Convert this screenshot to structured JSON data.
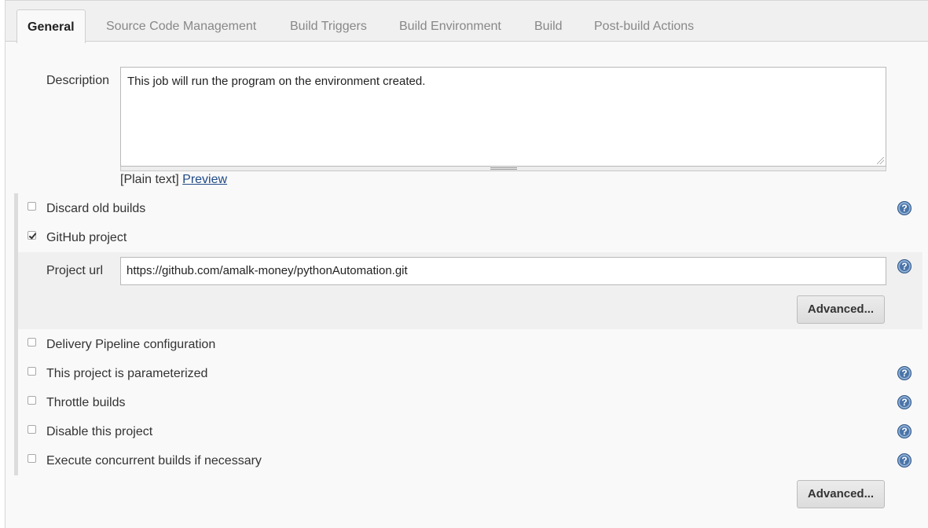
{
  "tabs": [
    {
      "label": "General",
      "active": true
    },
    {
      "label": "Source Code Management"
    },
    {
      "label": "Build Triggers"
    },
    {
      "label": "Build Environment"
    },
    {
      "label": "Build"
    },
    {
      "label": "Post-build Actions"
    }
  ],
  "description": {
    "label": "Description",
    "value": "This job will run the program on the environment created.",
    "format_text": "[Plain text]",
    "preview_link": "Preview"
  },
  "options": [
    {
      "label": "Discard old builds",
      "checked": false,
      "help": true
    },
    {
      "label": "GitHub project",
      "checked": true,
      "help": false
    },
    {
      "label": "Delivery Pipeline configuration",
      "checked": false,
      "help": false
    },
    {
      "label": "This project is parameterized",
      "checked": false,
      "help": true
    },
    {
      "label": "Throttle builds",
      "checked": false,
      "help": true
    },
    {
      "label": "Disable this project",
      "checked": false,
      "help": true
    },
    {
      "label": "Execute concurrent builds if necessary",
      "checked": false,
      "help": true
    }
  ],
  "github": {
    "url_label": "Project url",
    "url_value": "https://github.com/amalk-money/pythonAutomation.git",
    "advanced_label": "Advanced..."
  },
  "footer": {
    "advanced_label": "Advanced..."
  },
  "help_glyph": "?",
  "colors": {
    "help_icon": "#4a74a8",
    "link": "#204a87",
    "panel_bg": "#f9f9f9"
  }
}
